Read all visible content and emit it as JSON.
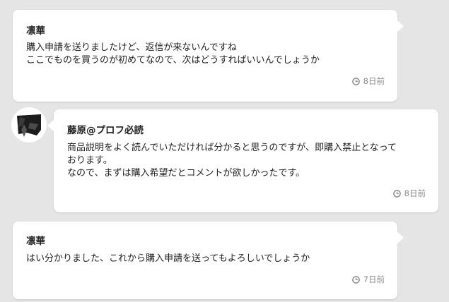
{
  "messages": [
    {
      "sender": "凛華",
      "lines": [
        "購入申請を送りましたけど、返信が来ないんですね",
        "ここでものを買うのが初めてなので、次はどうすればいいんでしょうか"
      ],
      "time": "8日前"
    },
    {
      "sender": "藤原@プロフ必読",
      "lines": [
        "商品説明をよく読んでいただければ分かると思うのですが、即購入禁止となって",
        "おります。",
        "なので、まずは購入希望だとコメントが欲しかったです。"
      ],
      "time": "8日前",
      "avatar": "user-avatar-image"
    },
    {
      "sender": "凛華",
      "lines": [
        "はい分かりました、これから購入申請を送ってもよろしいでしょうか"
      ],
      "time": "7日前"
    }
  ],
  "icons": {
    "time": "clock-icon"
  },
  "colors": {
    "background": "#e5e5e5",
    "bubble": "#ffffff",
    "meta": "#8a8a8a"
  }
}
